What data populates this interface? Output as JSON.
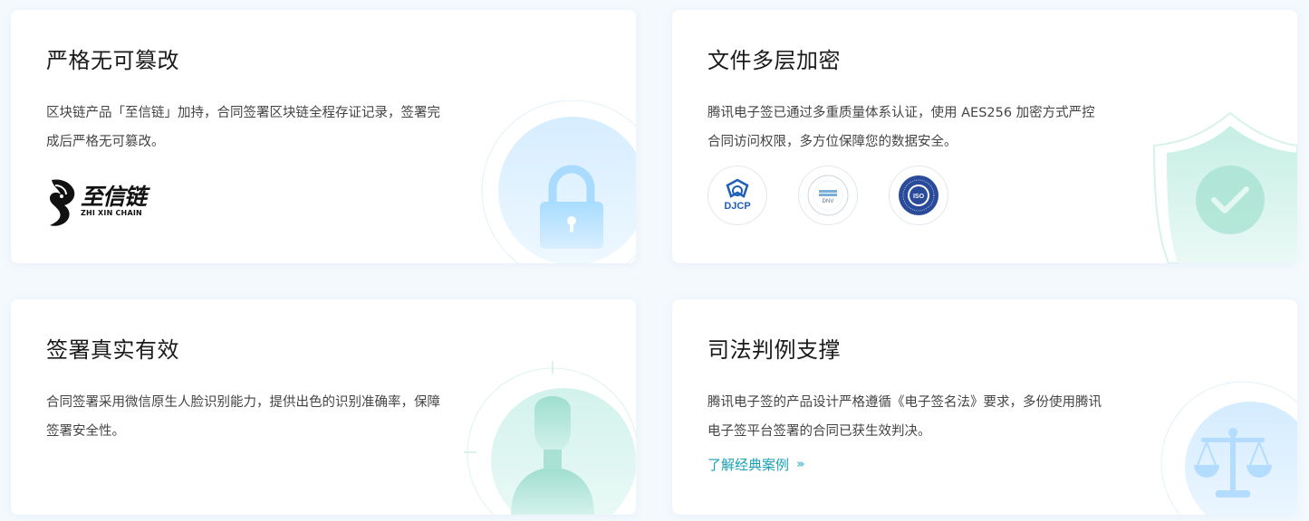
{
  "cards": [
    {
      "title": "严格无可篡改",
      "desc_lines": [
        "区块链产品「至信链」加持，合同签署区块链全程存证记录，签署完",
        "成后严格无可篡改。"
      ],
      "logo": {
        "name": "至信链",
        "subtitle": "ZHI XIN CHAIN"
      },
      "icon": "lock-icon"
    },
    {
      "title": "文件多层加密",
      "desc_lines": [
        "腾讯电子签已通过多重质量体系认证，使用 AES256 加密方式严控",
        "合同访问权限，多方位保障您的数据安全。"
      ],
      "badges": [
        {
          "name": "djcp-badge",
          "label": "DJCP"
        },
        {
          "name": "dnv-badge",
          "label": "DNV"
        },
        {
          "name": "iso-badge",
          "label": "ISO"
        }
      ],
      "icon": "shield-check-icon"
    },
    {
      "title": "签署真实有效",
      "desc_lines": [
        "合同签署采用微信原生人脸识别能力，提供出色的识别准确率，保障",
        "签署安全性。"
      ],
      "icon": "user-icon"
    },
    {
      "title": "司法判例支撑",
      "desc_lines": [
        "腾讯电子签的产品设计严格遵循《电子签名法》要求，多份使用腾讯",
        "电子签平台签署的合同已获生效判决。"
      ],
      "link": {
        "label": "了解经典案例",
        "arrow": "›››"
      },
      "icon": "scales-icon"
    }
  ],
  "colors": {
    "link": "#1aa0b4",
    "blue_deco": "#cfe9ff",
    "teal_deco": "#c9efe6"
  }
}
